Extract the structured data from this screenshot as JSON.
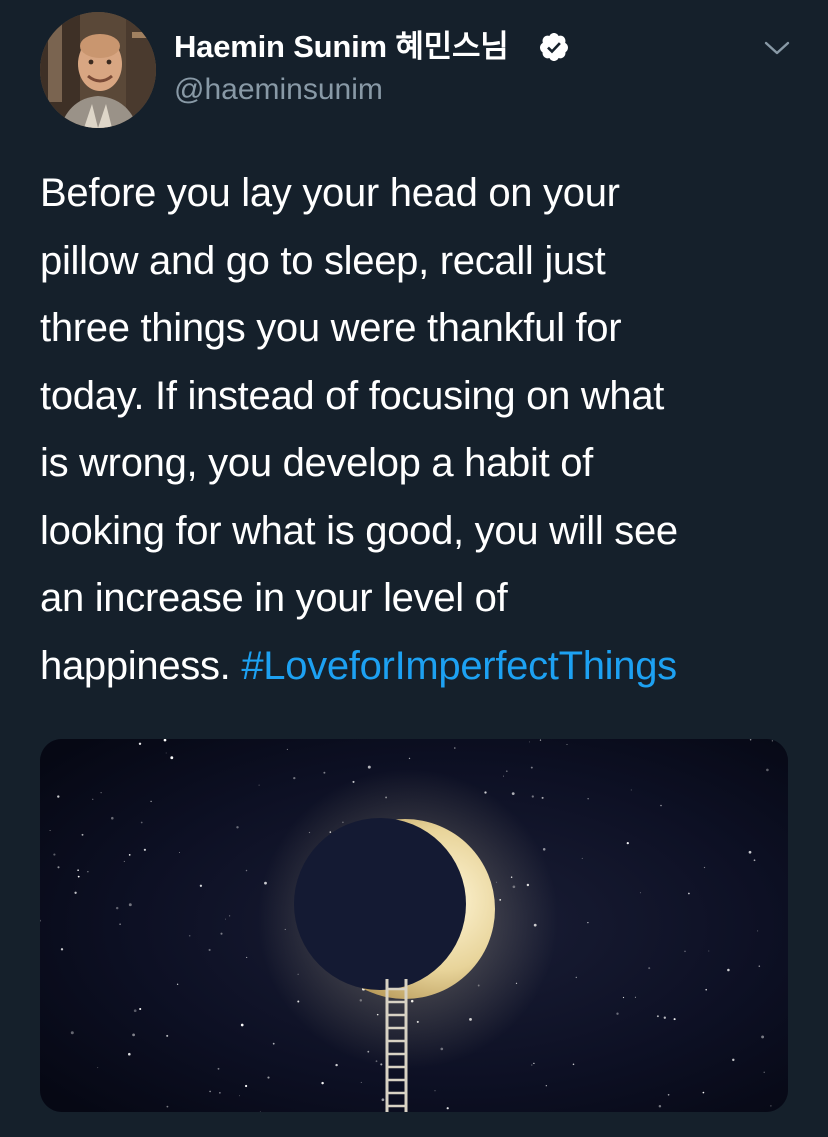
{
  "tweet": {
    "author": {
      "display_name": "Haemin Sunim 혜민스님",
      "handle": "@haeminsunim",
      "verified": true,
      "avatar_icon": "monk-portrait-avatar"
    },
    "menu_icon": "chevron-down-icon",
    "text_lines": [
      "Before you lay your head on your",
      "pillow and go to sleep, recall just",
      "three things you were thankful for",
      "today. If instead of focusing on what",
      "is wrong, you develop a habit of",
      "looking for what is good, you will see",
      "an increase in your level of",
      "happiness."
    ],
    "hashtag": "#LoveforImperfectThings",
    "media": {
      "description_icon": "crescent-moon-with-ladder-image"
    }
  },
  "colors": {
    "background": "#15202b",
    "text": "#ffffff",
    "secondary_text": "#8899a6",
    "link": "#1da1f2",
    "verified_badge": "#ffffff"
  }
}
